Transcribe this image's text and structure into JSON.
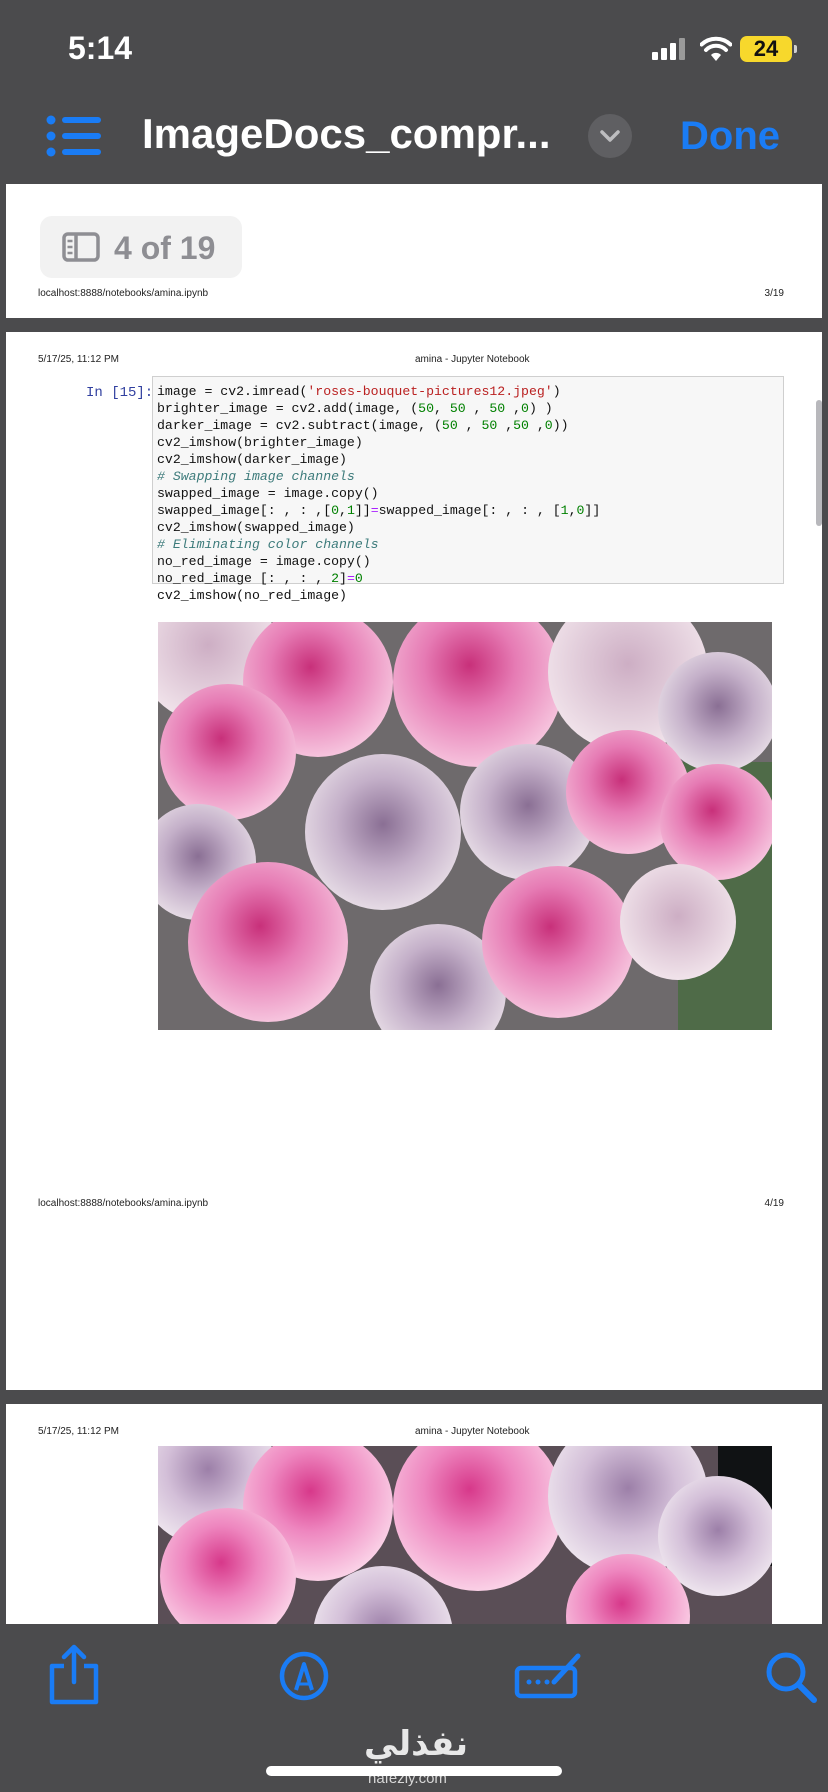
{
  "status_bar": {
    "time": "5:14",
    "battery": "24"
  },
  "nav_bar": {
    "title": "ImageDocs_compr...",
    "done_label": "Done"
  },
  "page_indicator": {
    "text": "4 of 19"
  },
  "pages": [
    {
      "footer_url": "localhost:8888/notebooks/amina.ipynb",
      "footer_page": "3/19"
    },
    {
      "header_date": "5/17/25, 11:12 PM",
      "header_title": "amina - Jupyter Notebook",
      "prompt": "In [15]:",
      "code_lines": [
        "image = cv2.imread('roses-bouquet-pictures12.jpeg')",
        "brighter_image = cv2.add(image, (50, 50 , 50 ,0) )",
        "darker_image = cv2.subtract(image, (50 , 50 ,50 ,0))",
        "cv2_imshow(brighter_image)",
        "cv2_imshow(darker_image)",
        "# Swapping image channels",
        "swapped_image = image.copy()",
        "swapped_image[: , : ,[0,1]]=swapped_image[: , : , [1,0]]",
        "cv2_imshow(swapped_image)",
        "# Eliminating color channels",
        "no_red_image = image.copy()",
        "no_red_image [: , : , 2]=0",
        "cv2_imshow(no_red_image)"
      ],
      "footer_url": "localhost:8888/notebooks/amina.ipynb",
      "footer_page": "4/19"
    },
    {
      "header_date": "5/17/25, 11:12 PM",
      "header_title": "amina - Jupyter Notebook"
    }
  ],
  "toolbar": {
    "icons": [
      "share-icon",
      "markup-icon",
      "signature-icon",
      "search-icon"
    ]
  },
  "watermark": {
    "arabic": "نفذلي",
    "latin": "nafezly.com"
  },
  "colors": {
    "accent": "#1a7cf5",
    "chrome": "#4b4b4d",
    "battery": "#f7d82c"
  }
}
